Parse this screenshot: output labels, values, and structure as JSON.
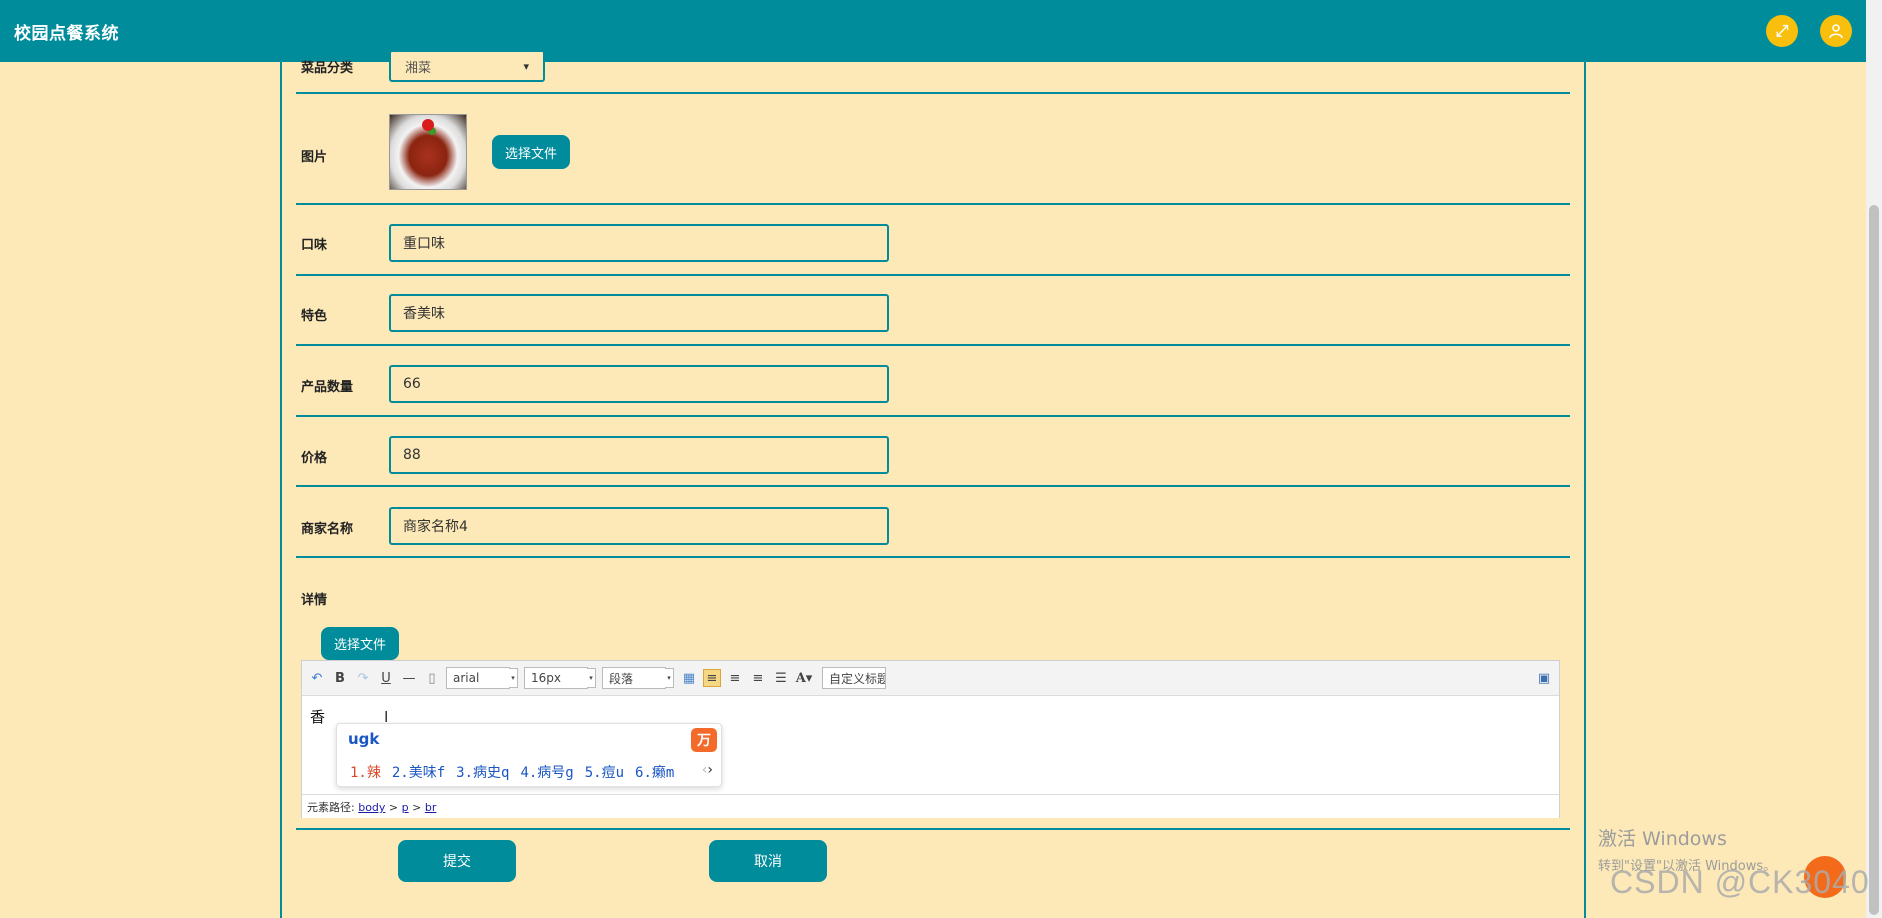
{
  "app": {
    "title": "校园点餐系统"
  },
  "header": {
    "fullscreen_icon": "expand-icon",
    "user_icon": "user-icon"
  },
  "form": {
    "category": {
      "label": "菜品分类",
      "value": "湘菜"
    },
    "image": {
      "label": "图片",
      "upload_label": "选择文件"
    },
    "taste": {
      "label": "口味",
      "value": "重口味"
    },
    "feature": {
      "label": "特色",
      "value": "香美味"
    },
    "quantity": {
      "label": "产品数量",
      "value": "66"
    },
    "price": {
      "label": "价格",
      "value": "88"
    },
    "merchant": {
      "label": "商家名称",
      "value": "商家名称4"
    },
    "detail": {
      "label": "详情",
      "upload_label": "选择文件"
    },
    "submit_label": "提交",
    "cancel_label": "取消"
  },
  "editor": {
    "font_family": "arial",
    "font_size": "16px",
    "paragraph": "段落",
    "custom_title": "自定义标题",
    "content": "香",
    "ime": {
      "typed": "ugk",
      "candidates": [
        "1.辣",
        "2.美味f",
        "3.病史q",
        "4.病号g",
        "5.痘u",
        "6.癞m"
      ]
    },
    "path": {
      "prefix": "元素路径:",
      "p1": "body",
      "p2": "p",
      "p3": "br"
    }
  },
  "watermark": {
    "line1": "激活 Windows",
    "line2": "转到\"设置\"以激活 Windows。",
    "csdn": "CSDN @CK3040"
  },
  "colors": {
    "accent": "#018c9c",
    "background": "#fde9b8",
    "header_icon": "#f8bf0c"
  }
}
